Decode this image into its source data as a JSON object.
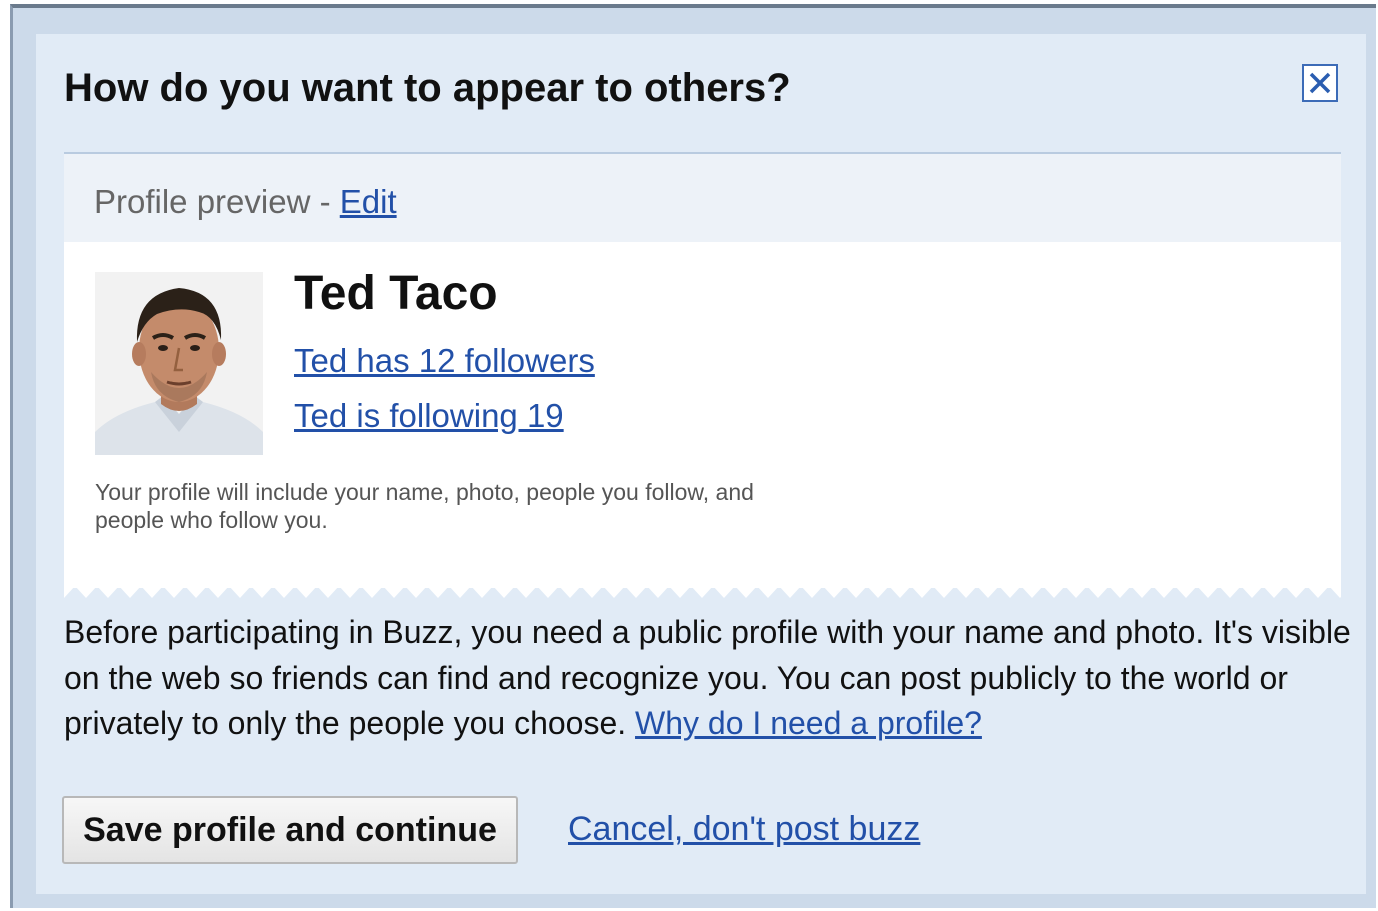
{
  "dialog": {
    "title": "How do you want to appear to others?",
    "close_label": "Close"
  },
  "preview": {
    "header_label": "Profile preview - ",
    "edit_link": "Edit",
    "name": "Ted Taco",
    "followers_link": "Ted has 12 followers",
    "following_link": "Ted is following 19",
    "note": "Your profile will include your name, photo, people you follow, and people who follow you."
  },
  "description": {
    "text": "Before participating in Buzz, you need a public profile with your name and photo. It's visible on the web so friends can find and recognize you. You can post publicly to the world or privately to only the people you choose. ",
    "link": "Why do I need a profile?"
  },
  "actions": {
    "save_label": "Save profile and continue",
    "cancel_label": "Cancel, don't post buzz"
  },
  "colors": {
    "frame_bg": "#ccdaea",
    "dialog_bg": "#e1ebf6",
    "link": "#2250a8",
    "header_bg": "#edf2f8"
  }
}
